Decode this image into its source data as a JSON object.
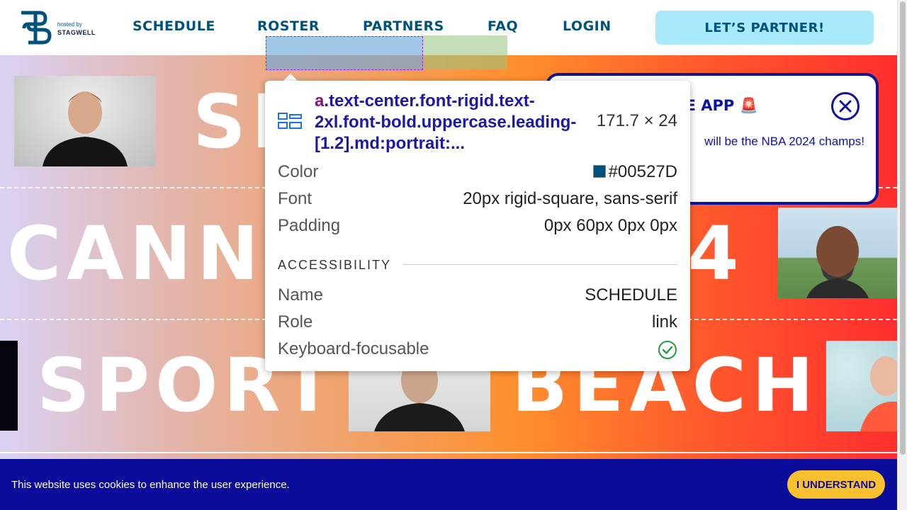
{
  "header": {
    "hosted_by": "hosted by",
    "host_name": "STAGWELL",
    "nav": [
      {
        "label": "SCHEDULE"
      },
      {
        "label": "ROSTER"
      },
      {
        "label": "PARTNERS"
      },
      {
        "label": "FAQ"
      },
      {
        "label": "LOGIN"
      }
    ],
    "cta_label": "LET’S PARTNER!"
  },
  "hero": {
    "lines": [
      "SP",
      "CANNE",
      "24",
      "SPORT",
      "BEACH"
    ],
    "gradient_colors": [
      "#d9d2f4",
      "#ff8f2c",
      "#ff2e2e"
    ]
  },
  "popup": {
    "title": "HE APP 🚨",
    "body": "will be the NBA 2024 champs!",
    "close_icon": "close-icon",
    "accent_color": "#0c14a0"
  },
  "devtools_tooltip": {
    "tag": "a",
    "selector": ".text-center.font-rigid.text-2xl.font-bold.uppercase.leading-[1.2].md:portrait:...",
    "size": "171.7 × 24",
    "color_label": "Color",
    "color_value": "#00527D",
    "font_label": "Font",
    "font_value": "20px rigid-square, sans-serif",
    "padding_label": "Padding",
    "padding_value": "0px 60px 0px 0px",
    "section": "ACCESSIBILITY",
    "name_label": "Name",
    "name_value": "SCHEDULE",
    "role_label": "Role",
    "role_value": "link",
    "focusable_label": "Keyboard-focusable"
  },
  "cookie": {
    "text": "This website uses cookies to enhance the user experience.",
    "button_label": "I UNDERSTAND"
  }
}
